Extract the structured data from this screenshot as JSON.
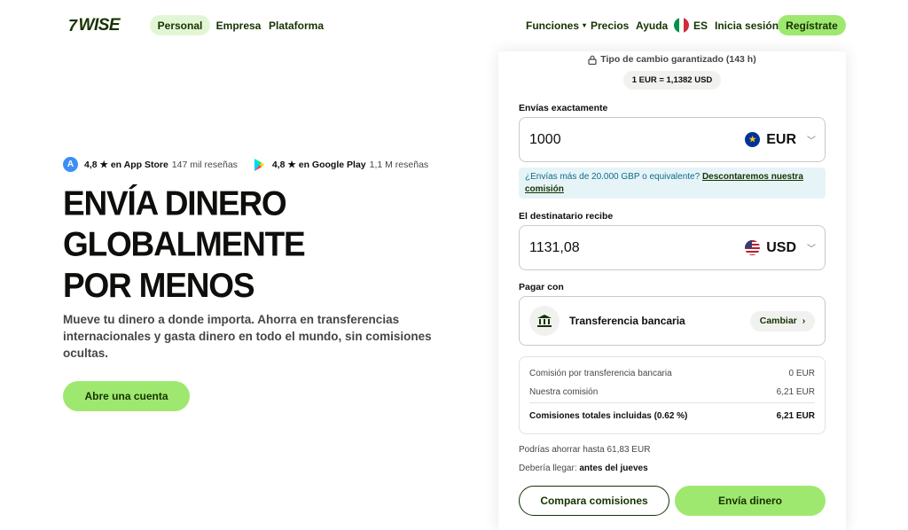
{
  "brand": {
    "logo_mark": "7",
    "logo_text": "WISE",
    "accent": "#9fe870",
    "dark": "#163300"
  },
  "nav": {
    "tabs": [
      {
        "label": "Personal",
        "active": true
      },
      {
        "label": "Empresa",
        "active": false
      },
      {
        "label": "Plataforma",
        "active": false
      }
    ],
    "funciones": "Funciones",
    "precios": "Precios",
    "ayuda": "Ayuda",
    "language": "ES",
    "login": "Inicia sesión",
    "register": "Regístrate"
  },
  "hero": {
    "appstore_rating": "4,8 ★ en App Store",
    "appstore_reviews": "147 mil reseñas",
    "gplay_rating": "4,8 ★ en Google Play",
    "gplay_reviews": "1,1 M reseñas",
    "title_lines": [
      "ENVÍA DINERO",
      "GLOBALMENTE",
      "POR MENOS"
    ],
    "subtitle": "Mueve tu dinero a donde importa. Ahorra en transferencias internacionales y gasta dinero en todo el mundo, sin comisiones ocultas.",
    "cta": "Abre una cuenta"
  },
  "calculator": {
    "rate_guarantee": "Tipo de cambio garantizado (143 h)",
    "rate": "1 EUR = 1,1382 USD",
    "send_label": "Envías exactamente",
    "send_amount": "1000",
    "send_currency": "EUR",
    "info_text": "¿Envías más de 20.000 GBP o equivalente?",
    "info_link": "Descontaremos nuestra comisión",
    "receive_label": "El destinatario recibe",
    "receive_amount": "1131,08",
    "receive_currency": "USD",
    "pay_label": "Pagar con",
    "pay_method": "Transferencia bancaria",
    "change": "Cambiar",
    "fees": [
      {
        "label": "Comisión por transferencia bancaria",
        "value": "0 EUR"
      },
      {
        "label": "Nuestra comisión",
        "value": "6,21 EUR"
      }
    ],
    "total_label": "Comisiones totales incluidas (0.62 %)",
    "total_value": "6,21 EUR",
    "savings": "Podrías ahorrar hasta 61,83 EUR",
    "arrive_prefix": "Debería llegar:",
    "arrive_when": "antes del jueves",
    "compare_btn": "Compara comisiones",
    "send_btn": "Envía dinero"
  }
}
